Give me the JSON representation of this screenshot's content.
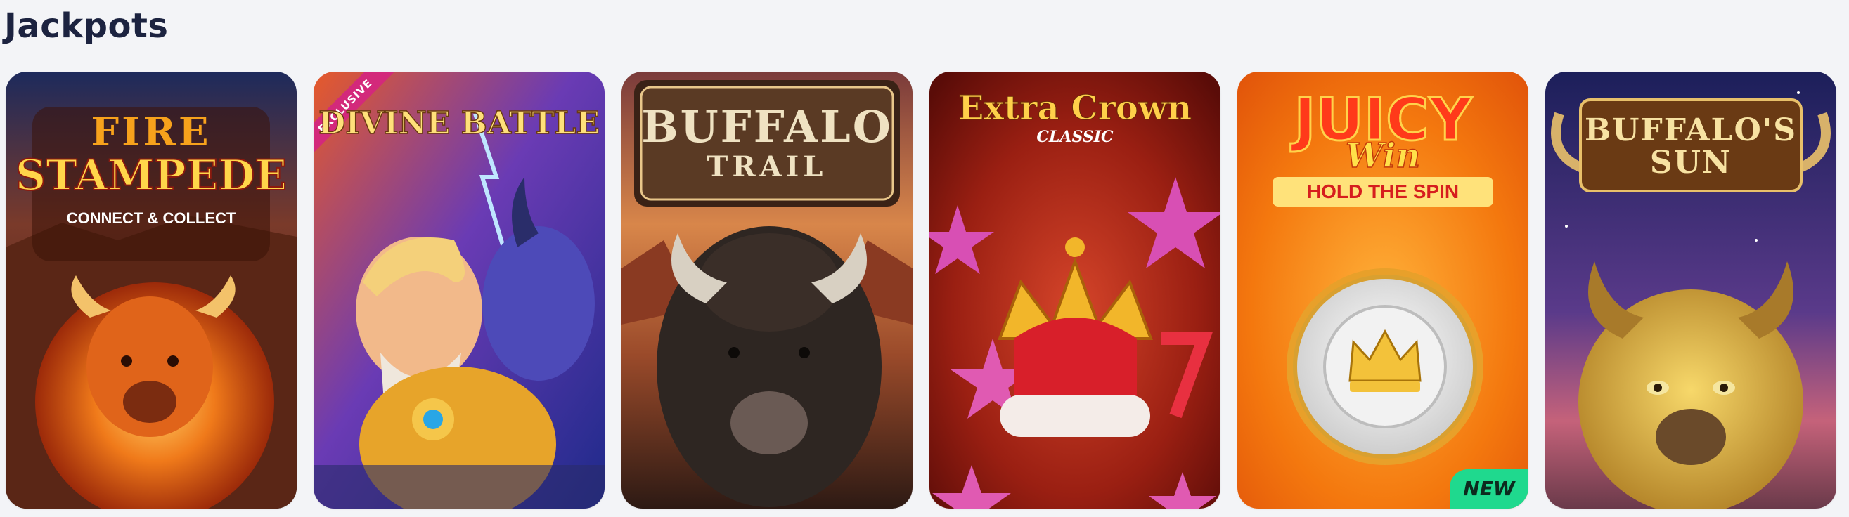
{
  "section": {
    "title": "Jackpots"
  },
  "games": [
    {
      "logo_line1": "FIRE",
      "logo_line2": "STAMPEDE",
      "logo_sub": "CONNECT & COLLECT"
    },
    {
      "ribbon": "EXCLUSIVE",
      "logo_line1": "DIVINE BATTLE"
    },
    {
      "logo_line1": "BUFFALO",
      "logo_line2": "TRAIL"
    },
    {
      "logo_line1": "Extra Crown",
      "logo_sub": "CLASSIC"
    },
    {
      "logo_line1": "JUICY",
      "logo_line2": "Win",
      "logo_sub": "HOLD THE SPIN",
      "badge": "NEW"
    },
    {
      "logo_line1": "BUFFALO'S",
      "logo_line2": "SUN"
    }
  ],
  "colors": {
    "title": "#1c2340",
    "exclusive_ribbon": "#d3297b",
    "new_badge": "#1fd98e"
  }
}
